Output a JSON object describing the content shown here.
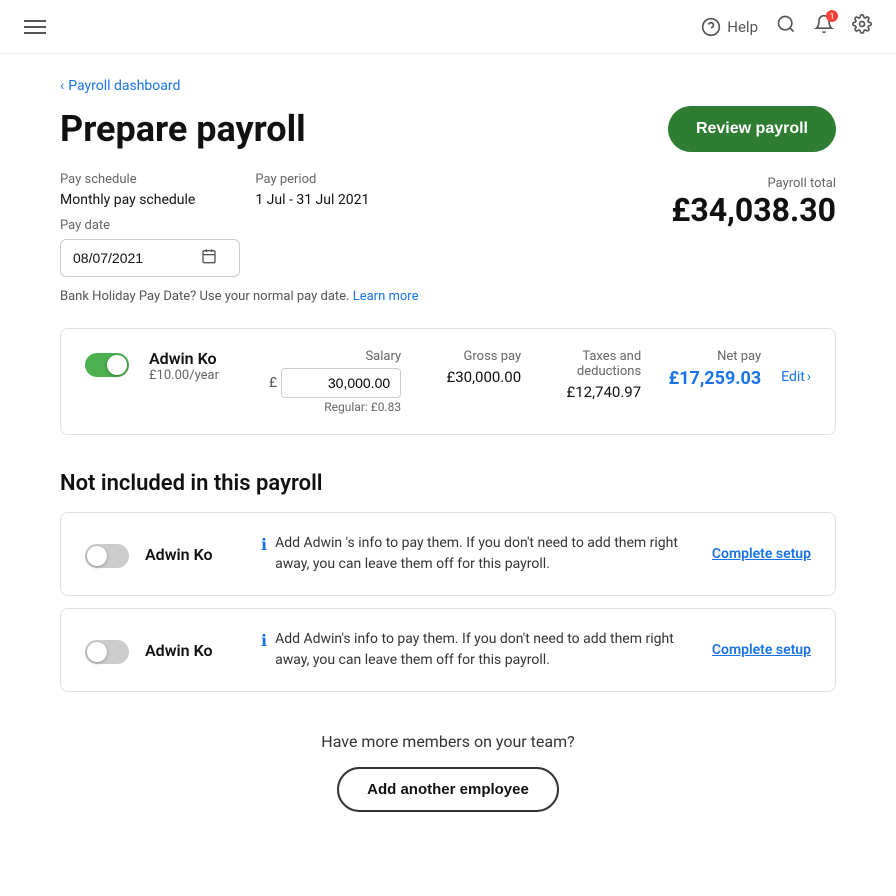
{
  "header": {
    "help_label": "Help"
  },
  "breadcrumb": {
    "label": "Payroll dashboard"
  },
  "page": {
    "title": "Prepare payroll",
    "review_button": "Review payroll"
  },
  "pay_info": {
    "schedule_label": "Pay schedule",
    "schedule_value": "Monthly pay schedule",
    "period_label": "Pay period",
    "period_value": "1 Jul - 31 Jul 2021",
    "total_label": "Payroll total",
    "total_value": "£34,038.30",
    "date_label": "Pay date",
    "date_value": "08/07/2021"
  },
  "bank_note": {
    "text": "Bank Holiday Pay Date? Use your normal pay date.",
    "link": "Learn more"
  },
  "employee": {
    "name": "Adwin Ko",
    "rate": "£10.00/year",
    "salary_label": "Salary",
    "salary_value": "30,000.00",
    "salary_regular": "Regular: £0.83",
    "gross_label": "Gross pay",
    "gross_value": "£30,000.00",
    "taxes_label": "Taxes and deductions",
    "taxes_value": "£12,740.97",
    "net_label": "Net pay",
    "net_value": "£17,259.03",
    "edit_label": "Edit"
  },
  "not_included": {
    "section_title": "Not included in this payroll",
    "items": [
      {
        "name": "Adwin Ko",
        "info_text": "Add Adwin 's info to pay them. If you don't need to add them right away, you can leave them off for this payroll.",
        "action": "Complete setup"
      },
      {
        "name": "Adwin Ko",
        "info_text": "Add Adwin's info to pay them. If you don't need to add them right away, you can leave them off for this payroll.",
        "action": "Complete setup"
      }
    ]
  },
  "bottom_cta": {
    "text": "Have more members on your team?",
    "button": "Add another employee"
  }
}
